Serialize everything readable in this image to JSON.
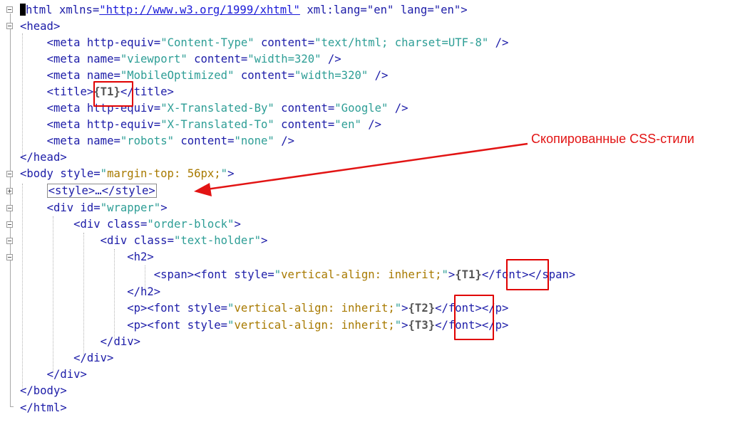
{
  "code": {
    "l1": {
      "open": "html xmlns=",
      "url": "\"http://www.w3.org/1999/xhtml\"",
      "rest": " xml:lang=\"en\" lang=\"en\">"
    },
    "l2": "<head>",
    "l3": {
      "tag": "<meta",
      "a1": " http-equiv=",
      "v1": "\"Content-Type\"",
      "a2": " content=",
      "v2": "\"text/html; charset=UTF-8\"",
      "end": " />"
    },
    "l4": {
      "tag": "<meta",
      "a1": " name=",
      "v1": "\"viewport\"",
      "a2": " content=",
      "v2": "\"width=320\"",
      "end": " />"
    },
    "l5": {
      "tag": "<meta",
      "a1": " name=",
      "v1": "\"MobileOptimized\"",
      "a2": " content=",
      "v2": "\"width=320\"",
      "end": " />"
    },
    "l6": {
      "open": "<title>",
      "text": "{T1}",
      "close": "</title>"
    },
    "l7": {
      "tag": "<meta",
      "a1": " http-equiv=",
      "v1": "\"X-Translated-By\"",
      "a2": " content=",
      "v2": "\"Google\"",
      "end": " />"
    },
    "l8": {
      "tag": "<meta",
      "a1": " http-equiv=",
      "v1": "\"X-Translated-To\"",
      "a2": " content=",
      "v2": "\"en\"",
      "end": " />"
    },
    "l9": {
      "tag": "<meta",
      "a1": " name=",
      "v1": "\"robots\"",
      "a2": " content=",
      "v2": "\"none\"",
      "end": " />"
    },
    "l10": "</head>",
    "l11": {
      "tag": "<body",
      "a1": " style=",
      "q1": "\"",
      "s1": "margin-top: 56px;",
      "q2": "\"",
      "end": ">"
    },
    "l12": "<style>…</style>",
    "l13": {
      "tag": "<div",
      "a1": " id=",
      "v1": "\"wrapper\"",
      "end": ">"
    },
    "l14": {
      "tag": "<div",
      "a1": " class=",
      "v1": "\"order-block\"",
      "end": ">"
    },
    "l15": {
      "tag": "<div",
      "a1": " class=",
      "v1": "\"text-holder\"",
      "end": ">"
    },
    "l16": "<h2>",
    "l17": {
      "open": "<span><font style=",
      "q1": "\"",
      "s1": "vertical-align: inherit;",
      "q2": "\"",
      "gt": ">",
      "text": "{T1}",
      "close": "</font></span>"
    },
    "l18": "</h2>",
    "l19": {
      "open": "<p><font style=",
      "q1": "\"",
      "s1": "vertical-align: inherit;",
      "q2": "\"",
      "gt": ">",
      "text": "{T2}",
      "close": "</font></p>"
    },
    "l20": {
      "open": "<p><font style=",
      "q1": "\"",
      "s1": "vertical-align: inherit;",
      "q2": "\"",
      "gt": ">",
      "text": "{T3}",
      "close": "</font></p>"
    },
    "l21": "</div>",
    "l22": "</div>",
    "l23": "</div>",
    "l24": "</body>",
    "l25": "</html>"
  },
  "annotation": {
    "text": "Скопированные CSS-стили",
    "color": "#e21414"
  },
  "colors": {
    "tag": "#1c1ca8",
    "attr_value": "#2e9e96",
    "style_value": "#a87a00",
    "highlight": "#e00000"
  }
}
